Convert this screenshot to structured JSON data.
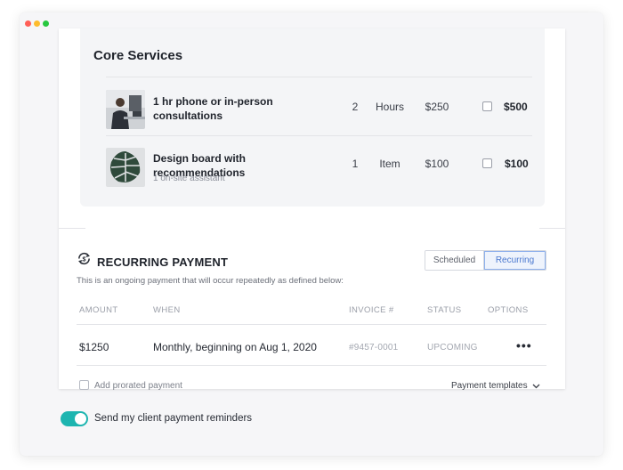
{
  "services": {
    "title": "Core Services",
    "items": [
      {
        "name": "1 hr phone or in-person consultations",
        "subtitle": "",
        "quantity": "2",
        "unit": "Hours",
        "rate": "$250",
        "total": "$500",
        "checked": false,
        "thumb_icon": "person-at-desk-photo"
      },
      {
        "name": "Design board with recommendations",
        "subtitle": "1 on-site assistant",
        "quantity": "1",
        "unit": "Item",
        "rate": "$100",
        "total": "$100",
        "checked": false,
        "thumb_icon": "monstera-leaf-photo"
      }
    ]
  },
  "recurring": {
    "title": "RECURRING PAYMENT",
    "description": "This is an ongoing payment that will occur repeatedly as defined below:",
    "icon": "recurring-dollar-icon",
    "tabs": [
      {
        "label": "Scheduled",
        "active": false
      },
      {
        "label": "Recurring",
        "active": true
      }
    ],
    "columns": [
      "AMOUNT",
      "WHEN",
      "INVOICE #",
      "STATUS",
      "OPTIONS"
    ],
    "rows": [
      {
        "amount": "$1250",
        "when": "Monthly, beginning on Aug 1, 2020",
        "invoice": "#9457-0001",
        "status": "UPCOMING",
        "options_icon": "more-horizontal-icon"
      }
    ],
    "prorated_label": "Add prorated payment",
    "prorated_checked": false,
    "templates_label": "Payment templates"
  },
  "reminders": {
    "label": "Send my client payment reminders",
    "enabled": true
  },
  "colors": {
    "accent_teal": "#1db5b0",
    "active_tab_blue": "#4a78cf"
  }
}
